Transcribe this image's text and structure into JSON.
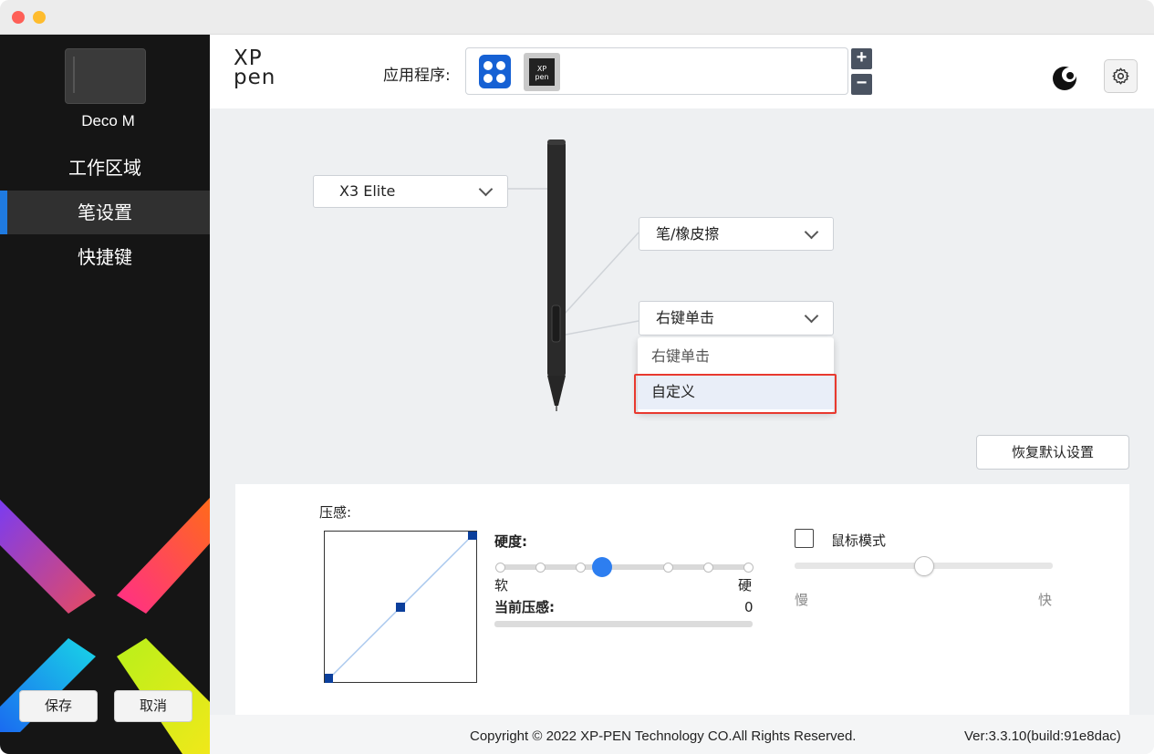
{
  "window": {
    "title": ""
  },
  "sidebar": {
    "device_name": "Deco M",
    "items": [
      {
        "label": "工作区域"
      },
      {
        "label": "笔设置"
      },
      {
        "label": "快捷键"
      }
    ],
    "save_label": "保存",
    "cancel_label": "取消"
  },
  "header": {
    "logo_line1": "XP",
    "logo_line2": "pen",
    "app_label": "应用程序:",
    "apps": [
      {
        "icon": "all-apps-icon"
      },
      {
        "icon": "xppen-app-icon",
        "text_line1": "XP",
        "text_line2": "pen"
      }
    ],
    "add_label": "+",
    "remove_label": "−"
  },
  "pen": {
    "model": "X3 Elite",
    "tip_function": "笔/橡皮擦",
    "button_function": "右键单击",
    "menu_options": [
      "右键单击",
      "自定义"
    ],
    "menu_selected": "自定义"
  },
  "restore_label": "恢复默认设置",
  "pressure": {
    "title": "压感:",
    "hardness_label": "硬度:",
    "soft_label": "软",
    "hard_label": "硬",
    "current_label": "当前压感:",
    "current_value": "0",
    "hardness_level": 0.41,
    "current_pressure_fraction": 0
  },
  "mouse_mode": {
    "label": "鼠标模式",
    "checked": false,
    "slow_label": "慢",
    "fast_label": "快",
    "speed_level": 0.5
  },
  "footer": {
    "copyright": "Copyright © 2022  XP-PEN Technology CO.All Rights Reserved.",
    "version": "Ver:3.3.10(build:91e8dac)"
  },
  "colors": {
    "accent": "#1f7ae0",
    "highlight_border": "#e8392f",
    "slider_knob": "#2d7ef0",
    "curve_point": "#0b3f9c"
  }
}
